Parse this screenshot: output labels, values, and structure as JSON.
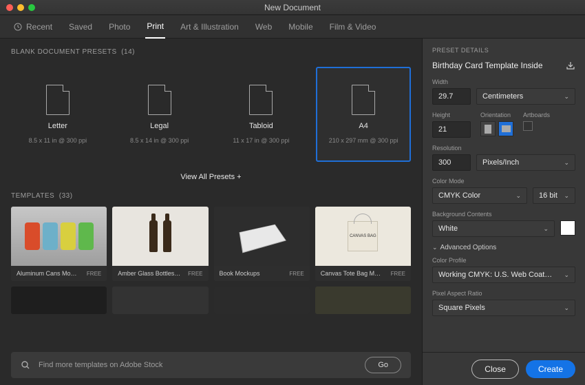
{
  "window": {
    "title": "New Document"
  },
  "tabs": {
    "recent": "Recent",
    "saved": "Saved",
    "photo": "Photo",
    "print": "Print",
    "art": "Art & Illustration",
    "web": "Web",
    "mobile": "Mobile",
    "film": "Film & Video"
  },
  "presets_header": "BLANK DOCUMENT PRESETS",
  "presets_count": "(14)",
  "presets": [
    {
      "name": "Letter",
      "sub": "8.5 x 11 in @ 300 ppi"
    },
    {
      "name": "Legal",
      "sub": "8.5 x 14 in @ 300 ppi"
    },
    {
      "name": "Tabloid",
      "sub": "11 x 17 in @ 300 ppi"
    },
    {
      "name": "A4",
      "sub": "210 x 297 mm @ 300 ppi"
    }
  ],
  "view_all": "View All Presets +",
  "templates_header": "TEMPLATES",
  "templates_count": "(33)",
  "templates": [
    {
      "name": "Aluminum Cans Moc…",
      "badge": "FREE"
    },
    {
      "name": "Amber Glass Bottles…",
      "badge": "FREE"
    },
    {
      "name": "Book Mockups",
      "badge": "FREE"
    },
    {
      "name": "Canvas Tote Bag Mo…",
      "badge": "FREE"
    }
  ],
  "search": {
    "placeholder": "Find more templates on Adobe Stock",
    "go": "Go"
  },
  "details": {
    "header": "PRESET DETAILS",
    "name": "Birthday Card Template Inside",
    "width_label": "Width",
    "width": "29.7",
    "units": "Centimeters",
    "height_label": "Height",
    "height": "21",
    "orientation_label": "Orientation",
    "artboards_label": "Artboards",
    "resolution_label": "Resolution",
    "resolution": "300",
    "res_units": "Pixels/Inch",
    "colormode_label": "Color Mode",
    "colormode": "CMYK Color",
    "bitdepth": "16 bit",
    "bg_label": "Background Contents",
    "bg": "White",
    "advanced": "Advanced Options",
    "profile_label": "Color Profile",
    "profile": "Working CMYK: U.S. Web Coated (S…",
    "par_label": "Pixel Aspect Ratio",
    "par": "Square Pixels"
  },
  "buttons": {
    "close": "Close",
    "create": "Create"
  },
  "bag_text": "CANVAS BAG"
}
